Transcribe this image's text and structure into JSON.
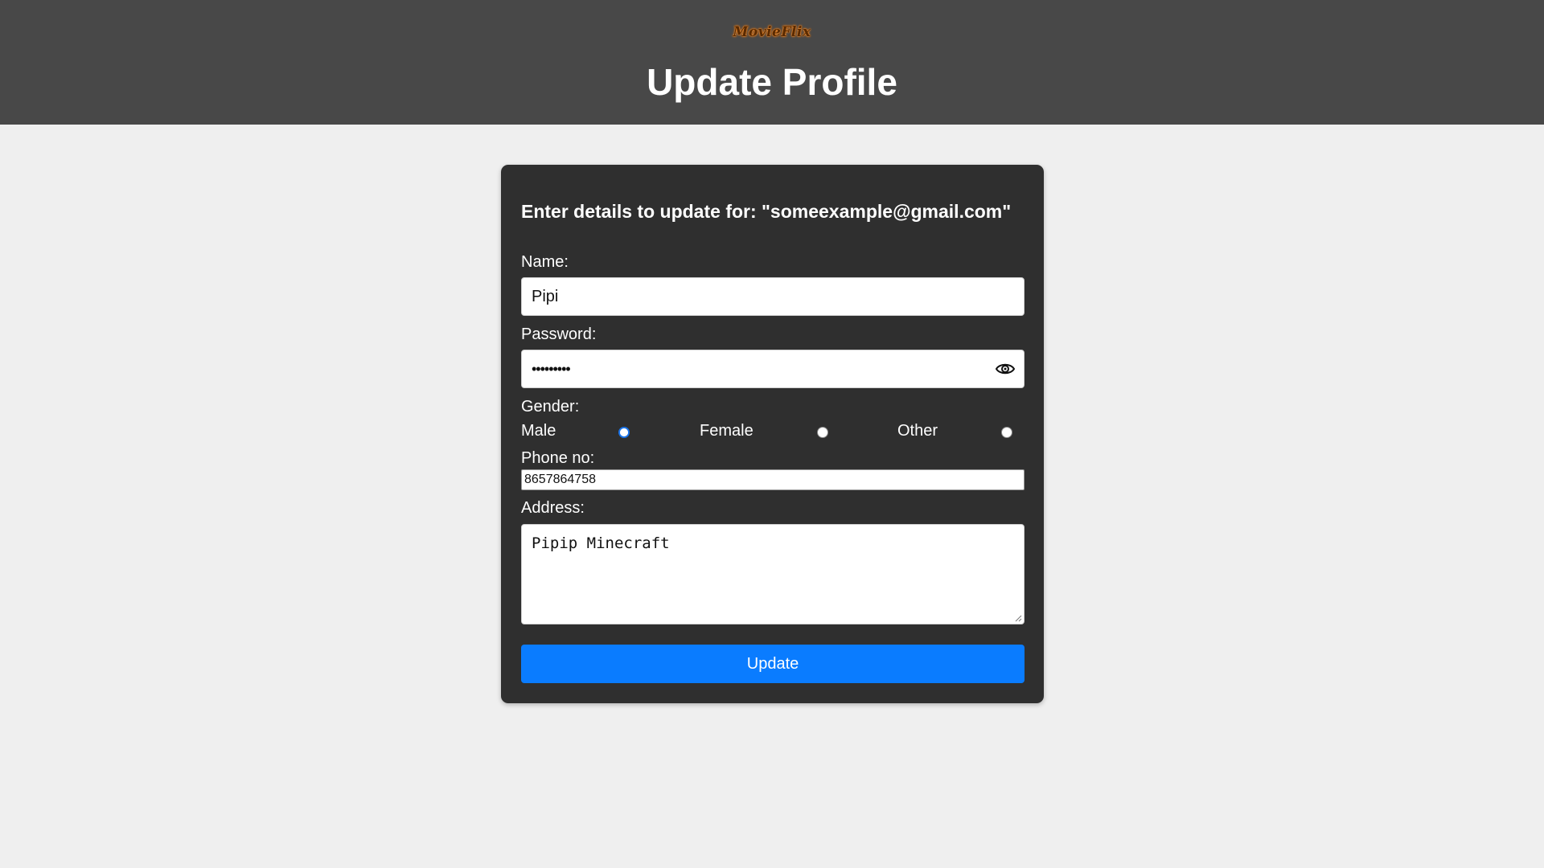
{
  "header": {
    "logo": "MovieFlix",
    "title": "Update Profile"
  },
  "form": {
    "heading": "Enter details to update for: \"someexample@gmail.com\"",
    "name_label": "Name:",
    "name_value": "Pipi",
    "password_label": "Password:",
    "password_value": "•••••••••",
    "password_toggle_icon": "eye-icon",
    "gender_label": "Gender:",
    "gender_options": [
      "Male",
      "Female",
      "Other"
    ],
    "gender_selected": "Male",
    "phone_label": "Phone no:",
    "phone_value": "8657864758",
    "address_label": "Address:",
    "address_value": "Pipip Minecraft",
    "submit_label": "Update"
  },
  "colors": {
    "header_bg": "#484848",
    "page_bg": "#efefef",
    "card_bg": "#2f2f2f",
    "button_bg": "#0a7cff",
    "radio_accent": "#1a73e8"
  }
}
